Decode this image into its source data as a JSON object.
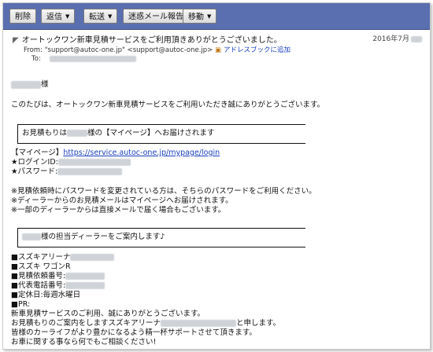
{
  "toolbar": {
    "buttons": [
      {
        "label": "削除",
        "dropdown": false
      },
      {
        "label": "返信",
        "dropdown": true
      },
      {
        "label": "転送",
        "dropdown": true
      },
      {
        "label": "迷惑メール報告",
        "dropdown": false
      },
      {
        "label": "移動",
        "dropdown": true
      }
    ]
  },
  "header": {
    "subject": "オートックワン新車見積サービスをご利用頂きありがとうございました。",
    "date": "2016年7月",
    "from_label": "From:",
    "from_address": "\"support@autoc-one.jp\" <support@autoc-one.jp>",
    "add_address_book": "アドレスブックに追加",
    "to_label": "To:"
  },
  "body": {
    "greeting_suffix": "様",
    "thanks": "このたびは、オートックワン新車見積サービスをご利用いただき誠にありがとうございます。",
    "box1_pre": "お見積もりは",
    "box1_post": "様の【マイページ】へお届けされます",
    "mypage_label": "【マイページ】",
    "mypage_url": "https://service.autoc-one.jp/mypage/login",
    "login_id_label": "★ログインID:",
    "password_label": "★パスワード:",
    "note1": "※見積依頼時にパスワードを変更されている方は、そちらのパスワードをご利用ください。",
    "note2": "※ディーラーからのお見積メールはマイページへお届けされます。",
    "note3": "※一部のディーラーからは直接メールで届く場合もございます。",
    "box2_post": "様の担当ディーラーをご案内します♪",
    "dealer_name": "■スズキアリーナ",
    "car_model": "■スズキ ワゴンR",
    "quote_no": "■見積依頼番号:",
    "phone": "■代表電話番号:",
    "holiday": "■定休日:毎週水曜日",
    "pr": "■PR:",
    "pr1": "新車見積サービスのご利用、誠にありがとうございます。",
    "pr2_pre": "お見積もりのご案内をしますスズキアリーナ",
    "pr2_post": "と申します。",
    "pr3": "皆様のカーライフがより豊かになるよう精一杯サポートさせて頂きます。",
    "pr4": "お車に関する事なら何でもご相談ください!"
  },
  "colors": {
    "toolbar_bg": "#5a6fb0",
    "link": "#1a3fbf"
  }
}
